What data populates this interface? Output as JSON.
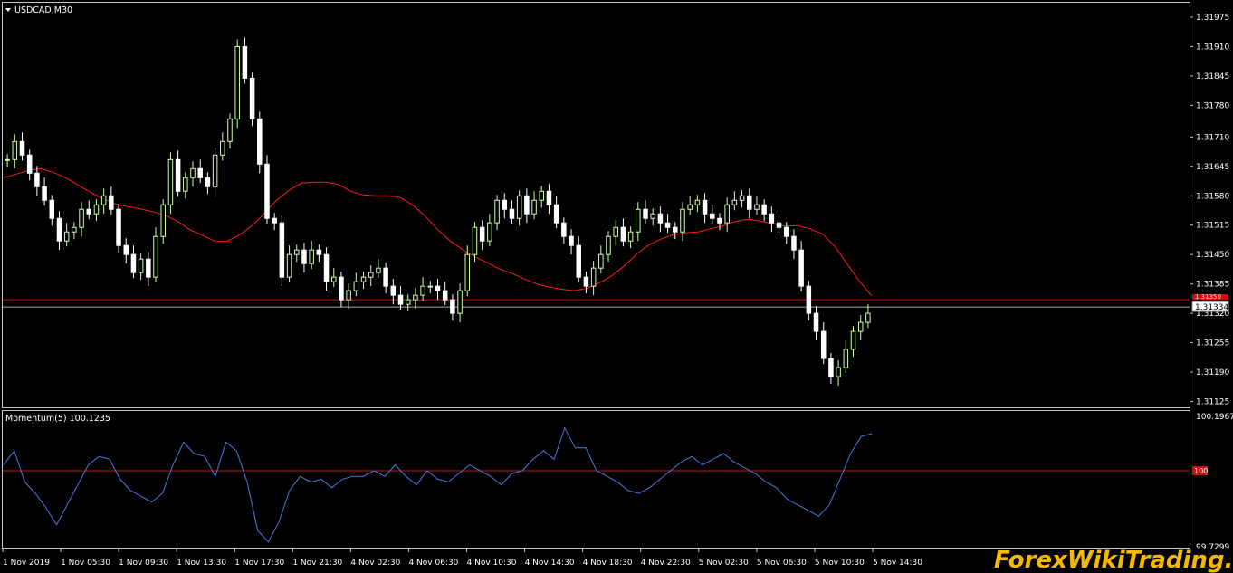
{
  "window": {
    "symbol_title": "USDCAD,M30",
    "indicator_title": "Momentum(5) 100.1235"
  },
  "watermark": "ForexWikiTrading.com",
  "colors": {
    "background": "#000000",
    "bull_candle": "#ccffaa",
    "bear_candle": "#ffffff",
    "moving_average": "#ff1a1a",
    "momentum": "#4a78e0",
    "level_line": "#d01010",
    "bid_line": "#aaaaaa"
  },
  "price_axis": {
    "labels": [
      "1.31975",
      "1.31910",
      "1.31845",
      "1.31780",
      "1.31710",
      "1.31645",
      "1.31580",
      "1.31515",
      "1.31450",
      "1.31385",
      "1.31320",
      "1.31255",
      "1.31190",
      "1.31125"
    ],
    "current_price": "1.31334",
    "red_marker": "1.31350"
  },
  "momentum_axis": {
    "labels": [
      "100.1967",
      "99.7299"
    ],
    "level_label": "100"
  },
  "time_axis": {
    "labels": [
      "1 Nov 2019",
      "1 Nov 05:30",
      "1 Nov 09:30",
      "1 Nov 13:30",
      "1 Nov 17:30",
      "1 Nov 21:30",
      "4 Nov 02:30",
      "4 Nov 06:30",
      "4 Nov 10:30",
      "4 Nov 14:30",
      "4 Nov 18:30",
      "4 Nov 22:30",
      "5 Nov 02:30",
      "5 Nov 06:30",
      "5 Nov 10:30",
      "5 Nov 14:30"
    ]
  },
  "chart_data": [
    {
      "type": "candlestick",
      "title": "USDCAD,M30",
      "ylim": [
        1.31112,
        1.32005
      ],
      "close": [
        1.3166,
        1.317,
        1.3167,
        1.3163,
        1.316,
        1.3157,
        1.3153,
        1.3148,
        1.315,
        1.3151,
        1.3155,
        1.3154,
        1.3156,
        1.3158,
        1.3155,
        1.3147,
        1.3145,
        1.3141,
        1.3144,
        1.314,
        1.3149,
        1.3156,
        1.3166,
        1.3159,
        1.3162,
        1.3164,
        1.3162,
        1.316,
        1.3167,
        1.317,
        1.3175,
        1.3191,
        1.3184,
        1.3175,
        1.3165,
        1.3153,
        1.3152,
        1.314,
        1.3145,
        1.3146,
        1.3143,
        1.3146,
        1.3145,
        1.3139,
        1.314,
        1.3135,
        1.3137,
        1.3139,
        1.314,
        1.3141,
        1.3142,
        1.3138,
        1.3136,
        1.3134,
        1.3135,
        1.3136,
        1.3138,
        1.3138,
        1.3137,
        1.3135,
        1.3132,
        1.3137,
        1.3145,
        1.3151,
        1.3148,
        1.3152,
        1.3157,
        1.3155,
        1.3153,
        1.3158,
        1.3154,
        1.3157,
        1.3159,
        1.3156,
        1.3152,
        1.3149,
        1.3147,
        1.314,
        1.3138,
        1.3142,
        1.3145,
        1.3149,
        1.3151,
        1.3148,
        1.315,
        1.3155,
        1.3153,
        1.3154,
        1.3152,
        1.3151,
        1.315,
        1.3155,
        1.3156,
        1.3157,
        1.3154,
        1.3153,
        1.3152,
        1.3156,
        1.3157,
        1.3158,
        1.3155,
        1.3156,
        1.3154,
        1.3152,
        1.3151,
        1.3149,
        1.3146,
        1.3138,
        1.3132,
        1.3128,
        1.3122,
        1.3118,
        1.312,
        1.3124,
        1.3128,
        1.313,
        1.3132
      ],
      "moving_average": {
        "close": [
          1.3162,
          1.31628,
          1.31636,
          1.3164,
          1.31632,
          1.3162,
          1.31604,
          1.31588,
          1.31574,
          1.31562,
          1.31556,
          1.31551,
          1.31545,
          1.31537,
          1.31524,
          1.31505,
          1.31493,
          1.3148,
          1.31479,
          1.31493,
          1.31513,
          1.3154,
          1.3157,
          1.31592,
          1.31608,
          1.3161,
          1.3161,
          1.31605,
          1.3159,
          1.31582,
          1.3158,
          1.3158,
          1.31576,
          1.31559,
          1.31535,
          1.31505,
          1.3148,
          1.31461,
          1.31445,
          1.31432,
          1.31418,
          1.31408,
          1.31396,
          1.31385,
          1.31378,
          1.31373,
          1.3137,
          1.31375,
          1.31387,
          1.31402,
          1.31424,
          1.3145,
          1.31471,
          1.31484,
          1.31494,
          1.31498,
          1.315,
          1.31507,
          1.31513,
          1.31523,
          1.31528,
          1.31524,
          1.31518,
          1.31513,
          1.31514,
          1.31507,
          1.31496,
          1.31469,
          1.3143,
          1.31391,
          1.31358
        ]
      },
      "bid_line": 1.31334,
      "marker_line": 1.3135
    },
    {
      "type": "line",
      "title": "Momentum(5) 100.1235",
      "ylim": [
        99.7299,
        100.1967
      ],
      "level": 100,
      "values": [
        100.02,
        100.07,
        99.96,
        99.92,
        99.87,
        99.81,
        99.88,
        99.95,
        100.02,
        100.05,
        100.04,
        99.97,
        99.93,
        99.91,
        99.89,
        99.92,
        100.02,
        100.1,
        100.06,
        100.05,
        99.98,
        100.1,
        100.07,
        99.96,
        99.79,
        99.75,
        99.82,
        99.93,
        99.98,
        99.96,
        99.97,
        99.94,
        99.97,
        99.98,
        99.98,
        100.0,
        99.98,
        100.02,
        99.98,
        99.95,
        100.0,
        99.97,
        99.96,
        99.99,
        100.02,
        100.0,
        99.98,
        99.95,
        99.99,
        100.0,
        100.04,
        100.07,
        100.04,
        100.15,
        100.08,
        100.08,
        100.0,
        99.98,
        99.96,
        99.93,
        99.92,
        99.94,
        99.97,
        100.0,
        100.03,
        100.05,
        100.02,
        100.04,
        100.06,
        100.03,
        100.01,
        99.99,
        99.96,
        99.94,
        99.9,
        99.88,
        99.86,
        99.84,
        99.88,
        99.97,
        100.06,
        100.12,
        100.13
      ]
    }
  ]
}
